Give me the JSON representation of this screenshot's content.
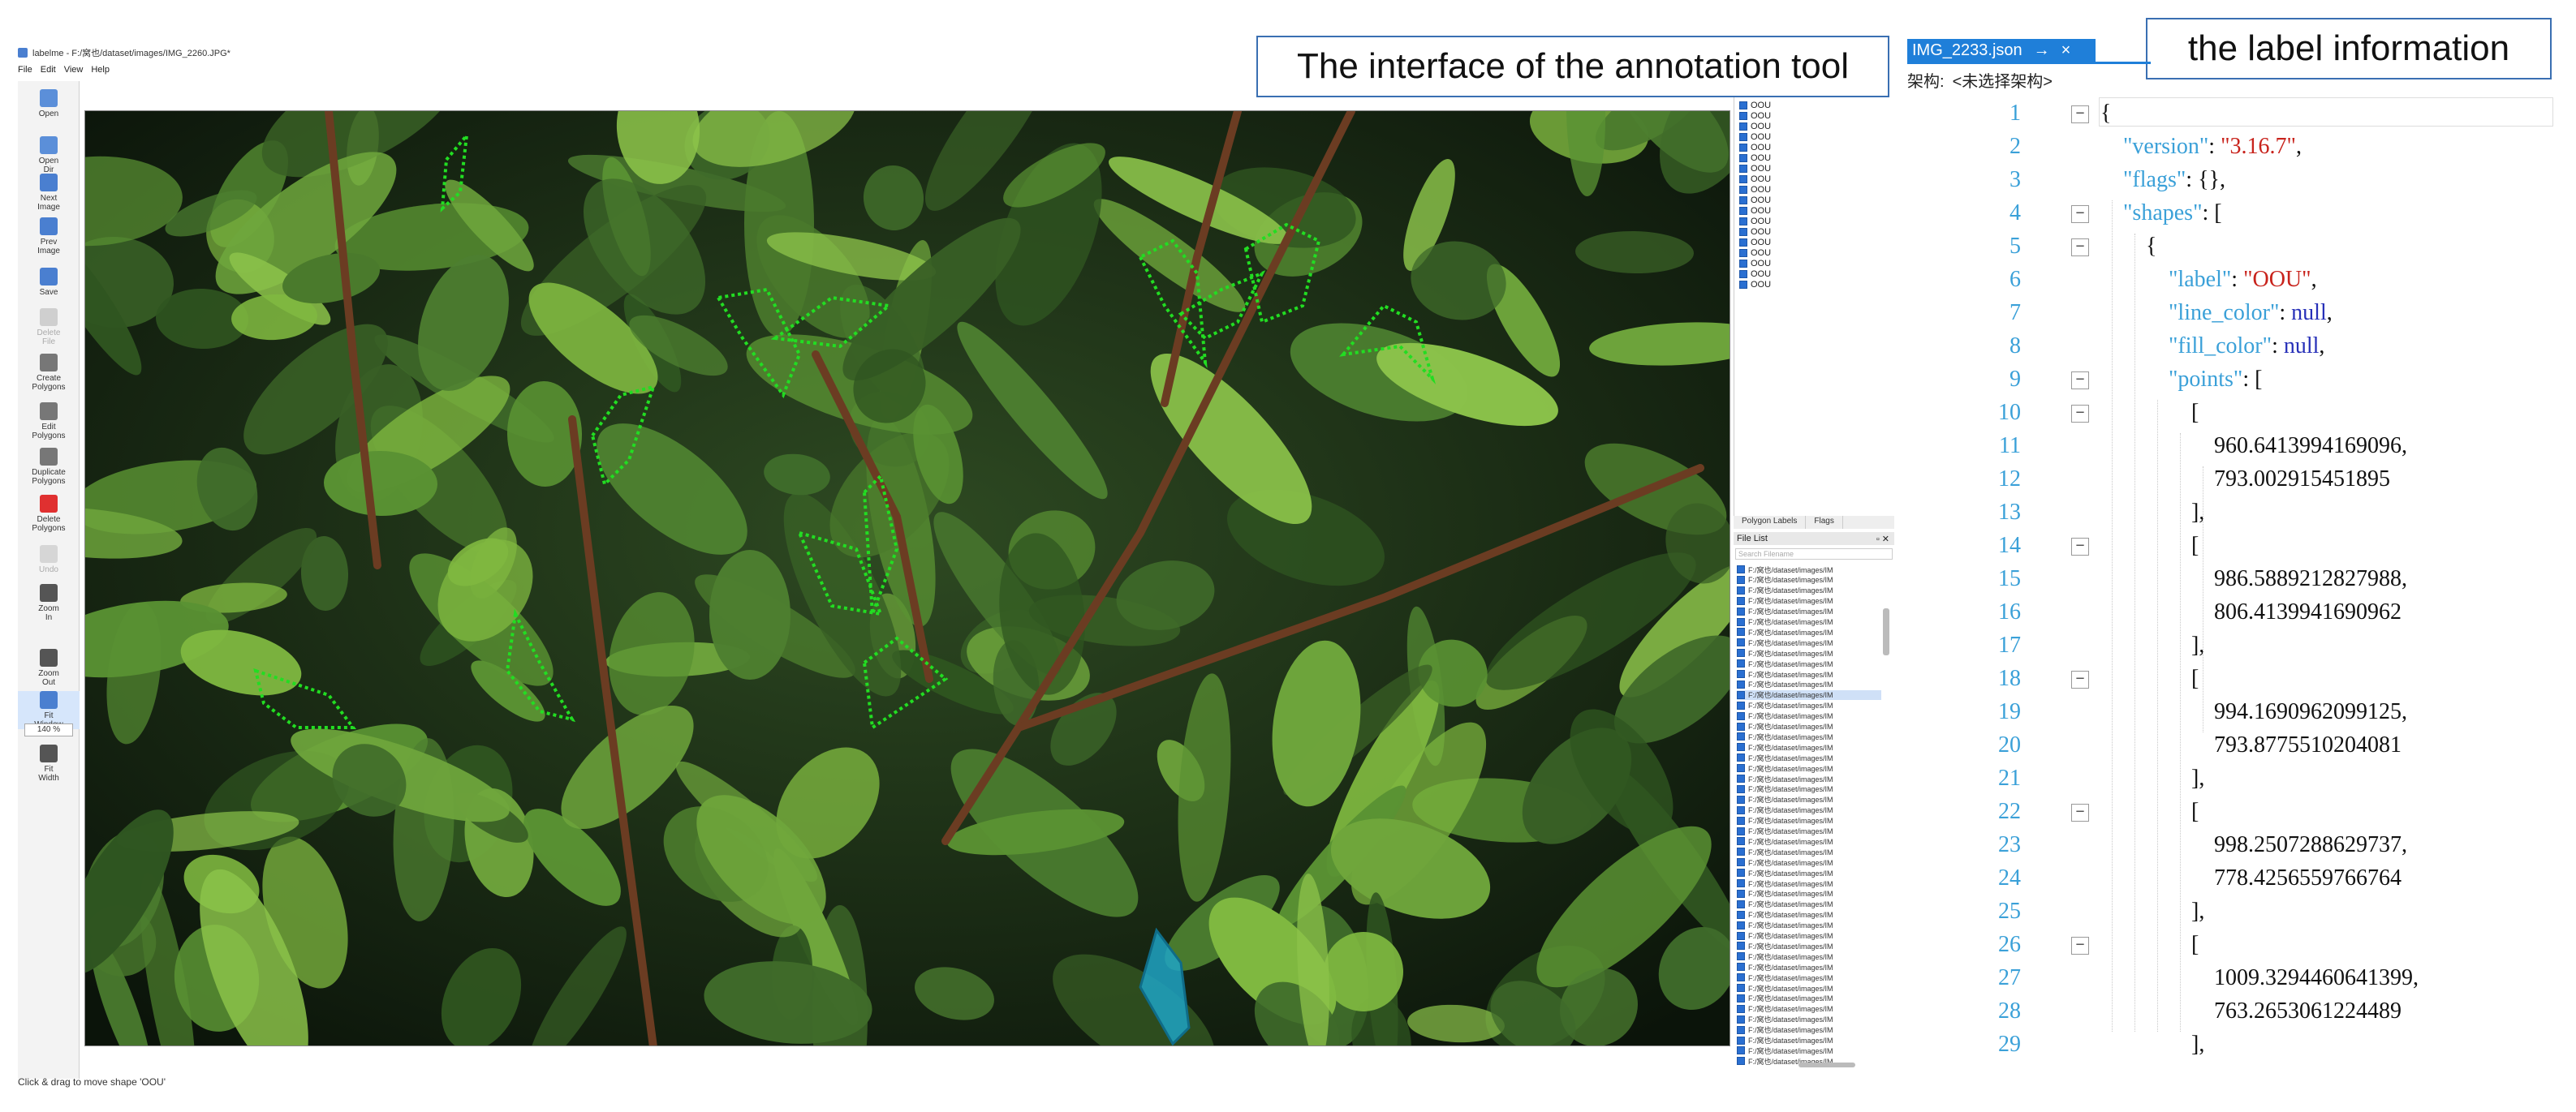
{
  "labelme": {
    "title": "labelme - F:/窝也/dataset/images/IMG_2260.JPG*",
    "menu": [
      "File",
      "Edit",
      "View",
      "Help"
    ],
    "tools": [
      {
        "label": "Open",
        "icon": "open-folder-icon"
      },
      {
        "label": "Open\nDir",
        "icon": "open-dir-icon"
      },
      {
        "label": "Next\nImage",
        "icon": "next-image-icon"
      },
      {
        "label": "Prev\nImage",
        "icon": "prev-image-icon"
      },
      {
        "label": "Save",
        "icon": "save-icon"
      },
      {
        "label": "Delete\nFile",
        "icon": "delete-file-icon"
      },
      {
        "label": "Create\nPolygons",
        "icon": "create-polygon-icon"
      },
      {
        "label": "Edit\nPolygons",
        "icon": "edit-polygon-icon"
      },
      {
        "label": "Duplicate\nPolygons",
        "icon": "duplicate-polygon-icon"
      },
      {
        "label": "Delete\nPolygons",
        "icon": "delete-polygon-icon"
      },
      {
        "label": "Undo",
        "icon": "undo-icon"
      },
      {
        "label": "Zoom\nIn",
        "icon": "zoom-in-icon"
      },
      {
        "label": "Zoom\nOut",
        "icon": "zoom-out-icon"
      },
      {
        "label": "Fit\nWindow",
        "icon": "fit-window-icon"
      },
      {
        "label": "Fit\nWidth",
        "icon": "fit-width-icon"
      }
    ],
    "zoom_value": "140 %",
    "status": "Click & drag to move shape 'OOU'",
    "labels": [
      "OOU",
      "OOU",
      "OOU",
      "OOU",
      "OOU",
      "OOU",
      "OOU",
      "OOU",
      "OOU",
      "OOU",
      "OOU",
      "OOU",
      "OOU",
      "OOU",
      "OOU",
      "OOU",
      "OOU",
      "OOU"
    ],
    "panel_tabs": [
      "Polygon Labels",
      "Flags"
    ],
    "file_list_title": "File List",
    "search_placeholder": "Search Filename",
    "files": [
      "F:/窝也/dataset/images/IM",
      "F:/窝也/dataset/images/IM",
      "F:/窝也/dataset/images/IM",
      "F:/窝也/dataset/images/IM",
      "F:/窝也/dataset/images/IM",
      "F:/窝也/dataset/images/IM",
      "F:/窝也/dataset/images/IM",
      "F:/窝也/dataset/images/IM",
      "F:/窝也/dataset/images/IM",
      "F:/窝也/dataset/images/IM",
      "F:/窝也/dataset/images/IM",
      "F:/窝也/dataset/images/IM",
      "F:/窝也/dataset/images/IM",
      "F:/窝也/dataset/images/IM",
      "F:/窝也/dataset/images/IM",
      "F:/窝也/dataset/images/IM",
      "F:/窝也/dataset/images/IM",
      "F:/窝也/dataset/images/IM",
      "F:/窝也/dataset/images/IM",
      "F:/窝也/dataset/images/IM",
      "F:/窝也/dataset/images/IM",
      "F:/窝也/dataset/images/IM",
      "F:/窝也/dataset/images/IM",
      "F:/窝也/dataset/images/IM",
      "F:/窝也/dataset/images/IM",
      "F:/窝也/dataset/images/IM",
      "F:/窝也/dataset/images/IM",
      "F:/窝也/dataset/images/IM",
      "F:/窝也/dataset/images/IM",
      "F:/窝也/dataset/images/IM",
      "F:/窝也/dataset/images/IM",
      "F:/窝也/dataset/images/IM",
      "F:/窝也/dataset/images/IM",
      "F:/窝也/dataset/images/IM",
      "F:/窝也/dataset/images/IM",
      "F:/窝也/dataset/images/IM",
      "F:/窝也/dataset/images/IM",
      "F:/窝也/dataset/images/IM",
      "F:/窝也/dataset/images/IM",
      "F:/窝也/dataset/images/IM",
      "F:/窝也/dataset/images/IM",
      "F:/窝也/dataset/images/IM",
      "F:/窝也/dataset/images/IM",
      "F:/窝也/dataset/images/IM",
      "F:/窝也/dataset/images/IM",
      "F:/窝也/dataset/images/IM",
      "F:/窝也/dataset/images/IM",
      "F:/窝也/dataset/images/IM"
    ],
    "selected_file_index": 12
  },
  "callouts": {
    "tool": "The interface of the annotation tool",
    "label": "the label information"
  },
  "editor": {
    "tab_title": "IMG_2233.json",
    "tab_pin": "→",
    "tab_close": "×",
    "struct_label": "架构:",
    "struct_value": "<未选择架构>",
    "line_numbers": [
      "1",
      "2",
      "3",
      "4",
      "5",
      "6",
      "7",
      "8",
      "9",
      "10",
      "11",
      "12",
      "13",
      "14",
      "15",
      "16",
      "17",
      "18",
      "19",
      "20",
      "21",
      "22",
      "23",
      "24",
      "25",
      "26",
      "27",
      "28",
      "29"
    ],
    "lines": [
      {
        "indent": 0,
        "parts": [
          [
            "p",
            "{"
          ]
        ]
      },
      {
        "indent": 1,
        "parts": [
          [
            "k",
            "\"version\""
          ],
          [
            "p",
            ": "
          ],
          [
            "s",
            "\"3.16.7\""
          ],
          [
            "p",
            ","
          ]
        ]
      },
      {
        "indent": 1,
        "parts": [
          [
            "k",
            "\"flags\""
          ],
          [
            "p",
            ": {},"
          ]
        ]
      },
      {
        "indent": 1,
        "parts": [
          [
            "k",
            "\"shapes\""
          ],
          [
            "p",
            ": ["
          ]
        ]
      },
      {
        "indent": 2,
        "parts": [
          [
            "p",
            "{"
          ]
        ]
      },
      {
        "indent": 3,
        "parts": [
          [
            "k",
            "\"label\""
          ],
          [
            "p",
            ": "
          ],
          [
            "s",
            "\"OOU\""
          ],
          [
            "p",
            ","
          ]
        ]
      },
      {
        "indent": 3,
        "parts": [
          [
            "k",
            "\"line_color\""
          ],
          [
            "p",
            ": "
          ],
          [
            "w",
            "null"
          ],
          [
            "p",
            ","
          ]
        ]
      },
      {
        "indent": 3,
        "parts": [
          [
            "k",
            "\"fill_color\""
          ],
          [
            "p",
            ": "
          ],
          [
            "w",
            "null"
          ],
          [
            "p",
            ","
          ]
        ]
      },
      {
        "indent": 3,
        "parts": [
          [
            "k",
            "\"points\""
          ],
          [
            "p",
            ": ["
          ]
        ]
      },
      {
        "indent": 4,
        "parts": [
          [
            "p",
            "["
          ]
        ]
      },
      {
        "indent": 5,
        "parts": [
          [
            "n",
            "960.6413994169096,"
          ]
        ]
      },
      {
        "indent": 5,
        "parts": [
          [
            "n",
            "793.002915451895"
          ]
        ]
      },
      {
        "indent": 4,
        "parts": [
          [
            "p",
            "],"
          ]
        ]
      },
      {
        "indent": 4,
        "parts": [
          [
            "p",
            "["
          ]
        ]
      },
      {
        "indent": 5,
        "parts": [
          [
            "n",
            "986.5889212827988,"
          ]
        ]
      },
      {
        "indent": 5,
        "parts": [
          [
            "n",
            "806.4139941690962"
          ]
        ]
      },
      {
        "indent": 4,
        "parts": [
          [
            "p",
            "],"
          ]
        ]
      },
      {
        "indent": 4,
        "parts": [
          [
            "p",
            "["
          ]
        ]
      },
      {
        "indent": 5,
        "parts": [
          [
            "n",
            "994.1690962099125,"
          ]
        ]
      },
      {
        "indent": 5,
        "parts": [
          [
            "n",
            "793.8775510204081"
          ]
        ]
      },
      {
        "indent": 4,
        "parts": [
          [
            "p",
            "],"
          ]
        ]
      },
      {
        "indent": 4,
        "parts": [
          [
            "p",
            "["
          ]
        ]
      },
      {
        "indent": 5,
        "parts": [
          [
            "n",
            "998.2507288629737,"
          ]
        ]
      },
      {
        "indent": 5,
        "parts": [
          [
            "n",
            "778.4256559766764"
          ]
        ]
      },
      {
        "indent": 4,
        "parts": [
          [
            "p",
            "],"
          ]
        ]
      },
      {
        "indent": 4,
        "parts": [
          [
            "p",
            "["
          ]
        ]
      },
      {
        "indent": 5,
        "parts": [
          [
            "n",
            "1009.3294460641399,"
          ]
        ]
      },
      {
        "indent": 5,
        "parts": [
          [
            "n",
            "763.2653061224489"
          ]
        ]
      },
      {
        "indent": 4,
        "parts": [
          [
            "p",
            "],"
          ]
        ]
      }
    ],
    "fold_lines": [
      1,
      4,
      5,
      9,
      10,
      14,
      18,
      22,
      26
    ]
  },
  "colors": {
    "annotation_outline": "#22dd22",
    "selected_shape_fill": "#1fa3c4",
    "tab_blue": "#1f7fd9",
    "json_key": "#3aa0d8",
    "json_string": "#c8231c",
    "json_null": "#2730b8"
  }
}
